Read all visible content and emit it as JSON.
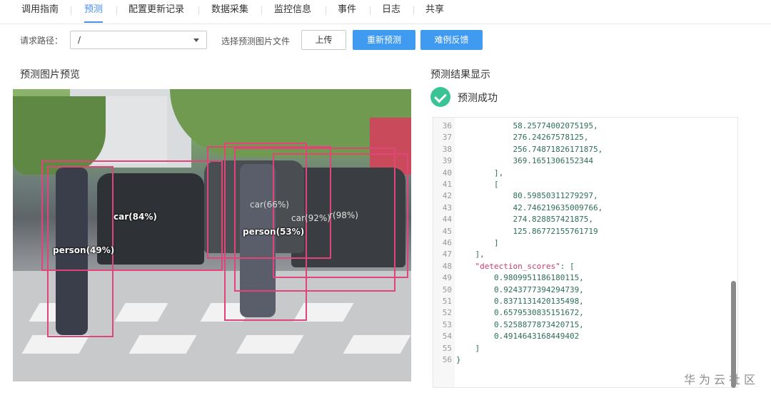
{
  "tabs": [
    {
      "label": "调用指南",
      "active": false
    },
    {
      "label": "预测",
      "active": true
    },
    {
      "label": "配置更新记录",
      "active": false
    },
    {
      "label": "数据采集",
      "active": false
    },
    {
      "label": "监控信息",
      "active": false
    },
    {
      "label": "事件",
      "active": false
    },
    {
      "label": "日志",
      "active": false
    },
    {
      "label": "共享",
      "active": false
    }
  ],
  "toolbar": {
    "path_label": "请求路径：",
    "path_value": "/",
    "choose_file_label": "选择预测图片文件",
    "upload_label": "上传",
    "repredict_label": "重新预测",
    "feedback_label": "难例反馈"
  },
  "preview": {
    "title": "预测图片预览",
    "detections": [
      {
        "label": "car(84%)"
      },
      {
        "label": "person(49%)"
      },
      {
        "label": "car(66%)"
      },
      {
        "label": "person(53%)"
      },
      {
        "label": "car(92%)"
      },
      {
        "label": "r(98%)"
      }
    ]
  },
  "result": {
    "title": "预测结果显示",
    "status": "预测成功",
    "lines": [
      {
        "n": "36",
        "t": "            58.25774002075195,"
      },
      {
        "n": "37",
        "t": "            276.24267578125,"
      },
      {
        "n": "38",
        "t": "            256.74871826171875,"
      },
      {
        "n": "39",
        "t": "            369.1651306152344"
      },
      {
        "n": "40",
        "t": "        ],"
      },
      {
        "n": "41",
        "t": "        ["
      },
      {
        "n": "42",
        "t": "            80.59850311279297,"
      },
      {
        "n": "43",
        "t": "            42.746219635009766,"
      },
      {
        "n": "44",
        "t": "            274.828857421875,"
      },
      {
        "n": "45",
        "t": "            125.86772155761719"
      },
      {
        "n": "46",
        "t": "        ]"
      },
      {
        "n": "47",
        "t": "    ],"
      },
      {
        "n": "48",
        "t": "    \"detection_scores\": ["
      },
      {
        "n": "49",
        "t": "        0.9809951186180115,"
      },
      {
        "n": "50",
        "t": "        0.9243777394294739,"
      },
      {
        "n": "51",
        "t": "        0.8371131420135498,"
      },
      {
        "n": "52",
        "t": "        0.6579530835151672,"
      },
      {
        "n": "53",
        "t": "        0.5258877873420715,"
      },
      {
        "n": "54",
        "t": "        0.4914643168449402"
      },
      {
        "n": "55",
        "t": "    ]"
      },
      {
        "n": "56",
        "t": "}"
      }
    ]
  },
  "watermark": "华为云社区",
  "colors": {
    "accent": "#4a8fe8",
    "primary_button": "#3f9af0",
    "success": "#3ac495",
    "bbox": "#e0457a"
  }
}
